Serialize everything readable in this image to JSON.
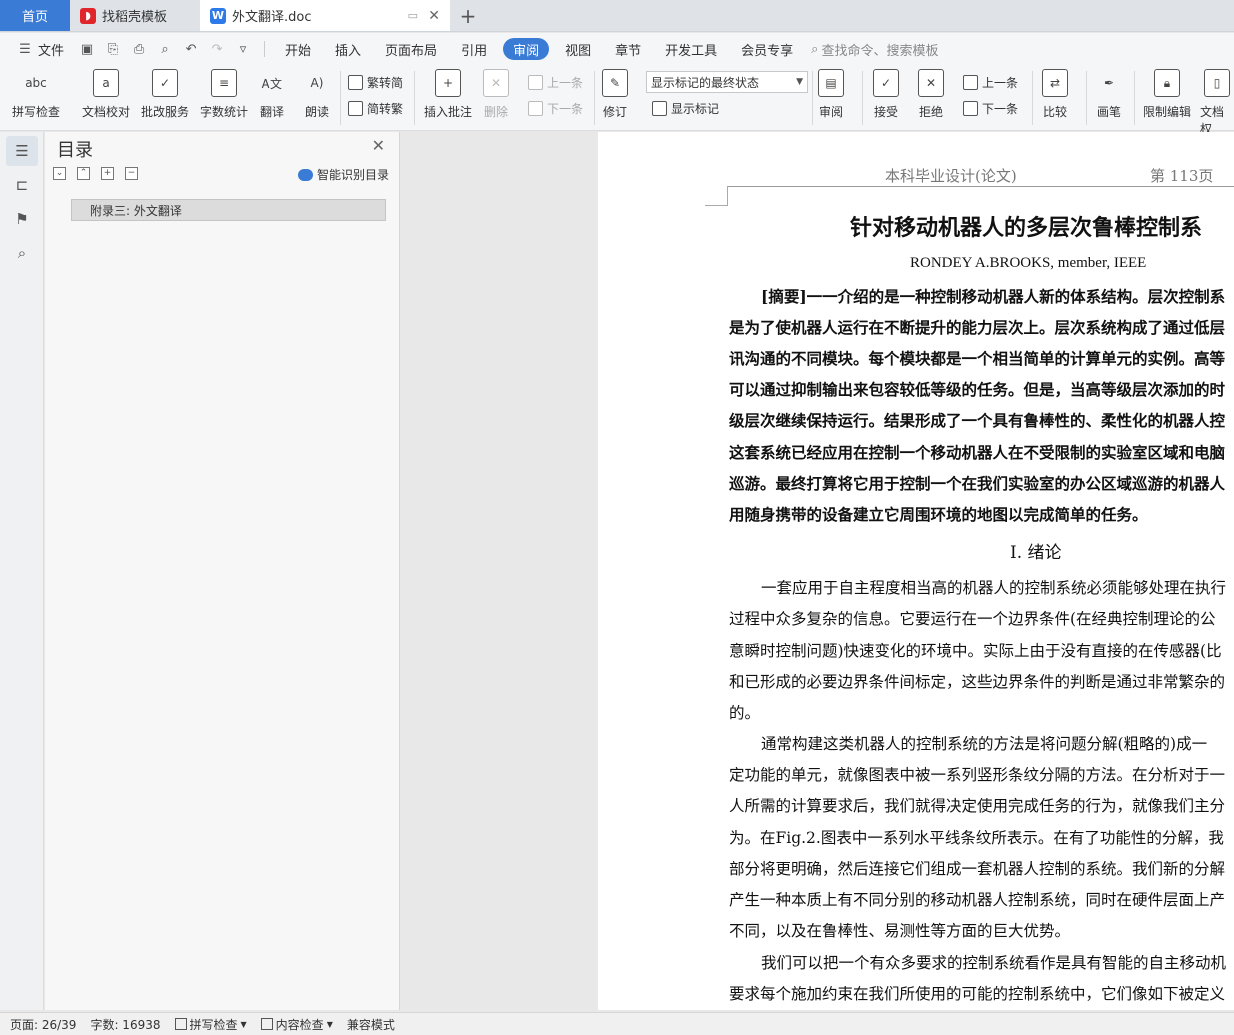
{
  "tabs": {
    "home": "首页",
    "templates": "找稻壳模板",
    "document": "外文翻译.doc"
  },
  "menu": {
    "file": "文件",
    "items": [
      "开始",
      "插入",
      "页面布局",
      "引用",
      "审阅",
      "视图",
      "章节",
      "开发工具",
      "会员专享"
    ],
    "active": "审阅",
    "search_placeholder": "查找命令、搜索模板"
  },
  "ribbon": {
    "spell_check": "拼写检查",
    "doc_proof": "文档校对",
    "correction_service": "批改服务",
    "word_count": "字数统计",
    "translate": "翻译",
    "read_aloud": "朗读",
    "trad_to_simp": "繁转简",
    "simp_to_trad": "简转繁",
    "insert_comment": "插入批注",
    "delete": "删除",
    "prev_comment": "上一条",
    "next_comment": "下一条",
    "track_changes": "修订",
    "markup_state": "显示标记的最终状态",
    "show_markup": "显示标记",
    "review": "审阅",
    "accept": "接受",
    "reject": "拒绝",
    "prev_change": "上一条",
    "next_change": "下一条",
    "compare": "比较",
    "ink": "画笔",
    "restrict_editing": "限制编辑",
    "doc_permission": "文档权"
  },
  "toc": {
    "title": "目录",
    "smart_toc": "智能识别目录",
    "items": [
      "附录三:  外文翻译"
    ]
  },
  "document": {
    "header_left": "本科毕业设计(论文)",
    "header_right": "第 113页",
    "title": "针对移动机器人的多层次鲁棒控制系",
    "author": "RONDEY A.BROOKS, member, IEEE",
    "abstract_lines": [
      "[摘要]一一介绍的是一种控制移动机器人新的体系结构。层次控制系",
      "是为了使机器人运行在不断提升的能力层次上。层次系统构成了通过低层",
      "讯沟通的不同模块。每个模块都是一个相当简单的计算单元的实例。高等",
      "可以通过抑制输出来包容较低等级的任务。但是，当高等级层次添加的时",
      "级层次继续保持运行。结果形成了一个具有鲁棒性的、柔性化的机器人控",
      "这套系统已经应用在控制一个移动机器人在不受限制的实验室区域和电脑",
      "巡游。最终打算将它用于控制一个在我们实验室的办公区域巡游的机器人",
      "用随身携带的设备建立它周围环境的地图以完成简单的任务。"
    ],
    "section_heading": "I.  绪论",
    "body_lines": [
      "一套应用于自主程度相当高的机器人的控制系统必须能够处理在执行",
      "过程中众多复杂的信息。它要运行在一个边界条件(在经典控制理论的公",
      "意瞬时控制问题)快速变化的环境中。实际上由于没有直接的在传感器(比",
      "和已形成的必要边界条件间标定，这些边界条件的判断是通过非常繁杂的",
      "的。",
      "通常构建这类机器人的控制系统的方法是将问题分解(粗略的)成一",
      "定功能的单元，就像图表中被一系列竖形条纹分隔的方法。在分析对于一",
      "人所需的计算要求后，我们就得决定使用完成任务的行为，就像我们主分",
      "为。在Fig.2.图表中一系列水平线条纹所表示。在有了功能性的分解，我",
      "部分将更明确，然后连接它们组成一套机器人控制的系统。我们新的分解",
      "产生一种本质上有不同分别的移动机器人控制系统，同时在硬件层面上产",
      "不同，以及在鲁棒性、易测性等方面的巨大优势。",
      "我们可以把一个有众多要求的控制系统看作是具有智能的自主移动机",
      "要求每个施加约束在我们所使用的可能的控制系统中，它们像如下被定义"
    ]
  },
  "status": {
    "page": "页面: 26/39",
    "word_count": "字数: 16938",
    "spell_check": "拼写检查",
    "content_check": "内容检查",
    "compat_mode": "兼容模式"
  },
  "colors": {
    "accent": "#3a7bd5",
    "tab_bar": "#dfe3e8",
    "toc_selected": "#dcdcdc"
  }
}
